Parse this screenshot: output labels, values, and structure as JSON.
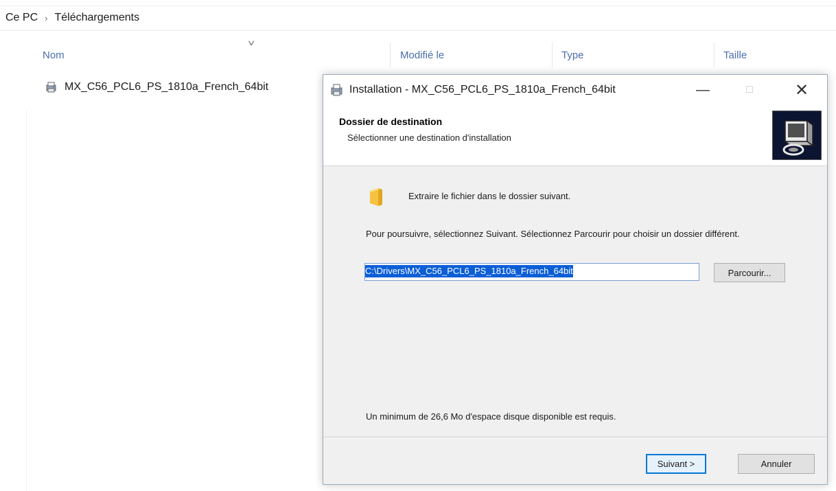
{
  "explorer": {
    "breadcrumb": [
      "Ce PC",
      "Téléchargements"
    ],
    "columns": {
      "name": "Nom",
      "modified": "Modifié le",
      "type": "Type",
      "size": "Taille"
    },
    "files": [
      {
        "name": "MX_C56_PCL6_PS_1810a_French_64bit",
        "icon": "installer-file-icon"
      }
    ]
  },
  "dialog": {
    "title": "Installation - MX_C56_PCL6_PS_1810a_French_64bit",
    "header_title": "Dossier de destination",
    "header_subtitle": "Sélectionner une destination d'installation",
    "extract_text": "Extraire le fichier dans le dossier suivant.",
    "description": "Pour poursuivre, sélectionnez Suivant.  Sélectionnez Parcourir pour choisir un dossier différent.",
    "path_value": "C:\\Drivers\\MX_C56_PCL6_PS_1810a_French_64bit",
    "browse_label": "Parcourir...",
    "space_text": "Un minimum de 26,6 Mo d'espace disque disponible est requis.",
    "next_label": "Suivant >",
    "cancel_label": "Annuler"
  },
  "colors": {
    "accent": "#0078d7",
    "selection": "#0b5ed7",
    "header_link": "#4a6ea9"
  }
}
